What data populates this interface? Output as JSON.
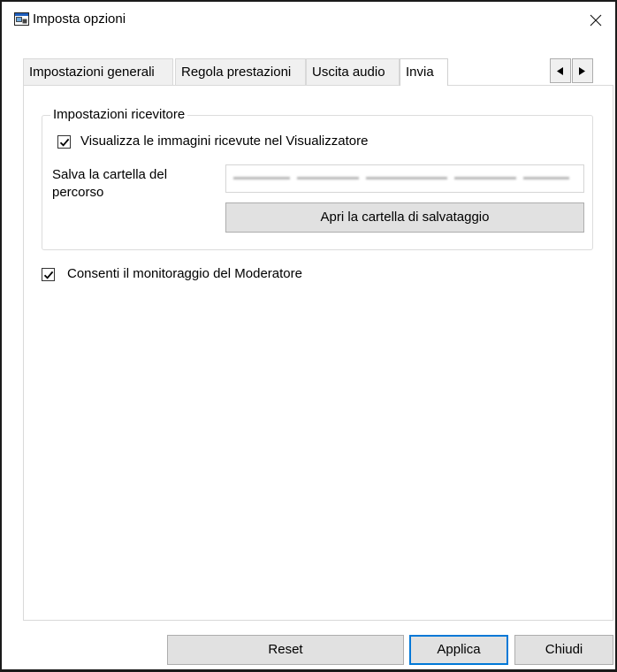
{
  "window": {
    "title": "Imposta opzioni",
    "close_glyph": "close-icon"
  },
  "tabs": [
    {
      "label": "Impostazioni generali"
    },
    {
      "label": "Regola prestazioni"
    },
    {
      "label": "Uscita audio"
    },
    {
      "label": "Invia",
      "active": true
    }
  ],
  "tab_scroll": {
    "left_icon": "triangle-left-icon",
    "right_icon": "triangle-right-icon"
  },
  "receiver_group": {
    "legend": "Impostazioni ricevitore",
    "show_in_viewer": {
      "label": "Visualizza le immagini ricevute nel Visualizzatore",
      "checked": true
    },
    "save_folder": {
      "label_line1": "Salva la cartella del",
      "label_line2": "percorso",
      "value_redacted": true
    },
    "open_folder_button": "Apri la cartella di salvataggio"
  },
  "moderator_monitoring": {
    "label": "Consenti il monitoraggio del Moderatore",
    "checked": true
  },
  "footer": {
    "reset": "Reset",
    "apply": "Applica",
    "close": "Chiudi"
  },
  "colors": {
    "accent_border": "#0078d7",
    "button_bg": "#e1e1e1",
    "tab_inactive_bg": "#f0f0f0"
  }
}
